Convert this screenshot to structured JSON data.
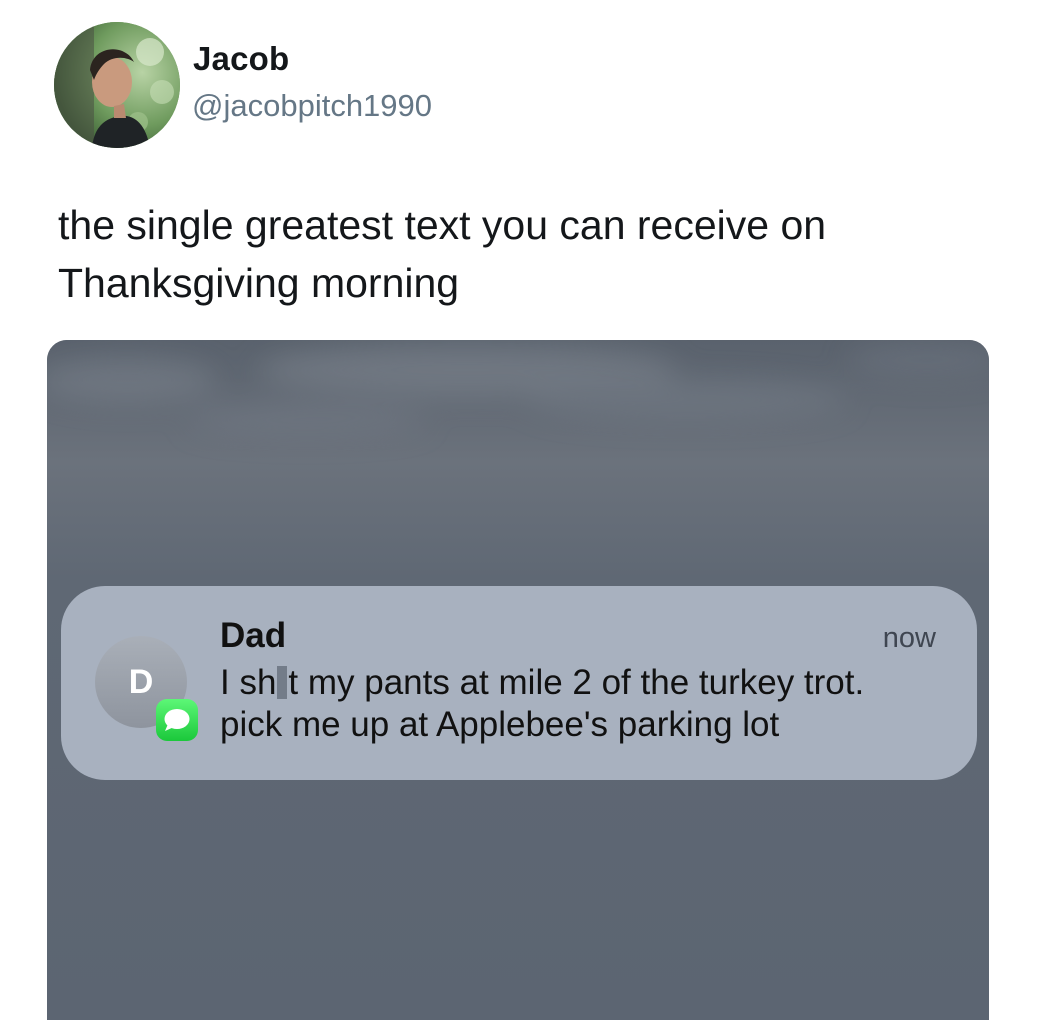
{
  "tweet": {
    "author": {
      "name": "Jacob",
      "handle": "@jacobpitch1990"
    },
    "text": "the single greatest text you can receive on Thanksgiving morning"
  },
  "notification": {
    "contact_initial": "D",
    "sender": "Dad",
    "time": "now",
    "message_line1_before": "I sh",
    "message_line1_after": "t my pants at mile 2 of the turkey trot.",
    "message_line2": "pick me up at Applebee's parking lot",
    "app_icon": "messages-icon"
  },
  "colors": {
    "handle_gray": "#657786",
    "banner_fill": "#a8b1bf",
    "wallpaper": "#5d6673",
    "messages_green": "#1bc83b"
  }
}
